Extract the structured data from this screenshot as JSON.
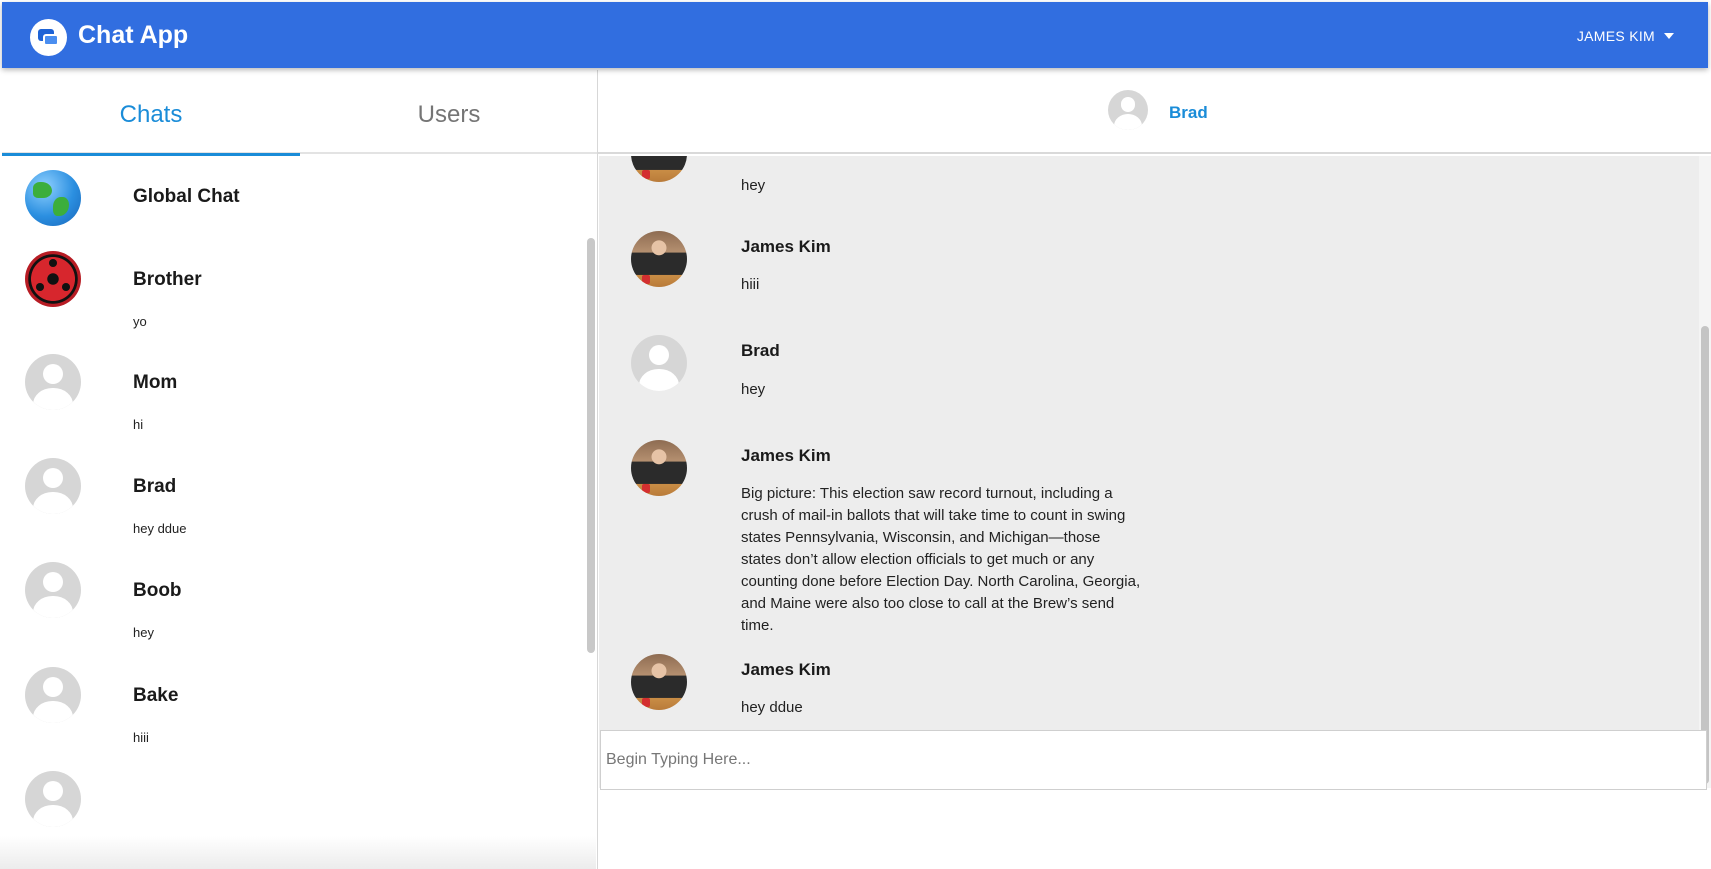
{
  "app": {
    "title": "Chat App",
    "current_user": "JAMES KIM"
  },
  "tabs": [
    {
      "label": "Chats",
      "active": true
    },
    {
      "label": "Users",
      "active": false
    }
  ],
  "chats": [
    {
      "name": "Global Chat",
      "preview": "",
      "avatar": "globe-icon"
    },
    {
      "name": "Brother",
      "preview": "yo",
      "avatar": "sharingan-icon"
    },
    {
      "name": "Mom",
      "preview": "hi",
      "avatar": "default-user-icon"
    },
    {
      "name": "Brad",
      "preview": "hey ddue",
      "avatar": "default-user-icon"
    },
    {
      "name": "Boob",
      "preview": "hey",
      "avatar": "default-user-icon"
    },
    {
      "name": "Bake",
      "preview": "hiii",
      "avatar": "default-user-icon"
    }
  ],
  "conversation": {
    "with": "Brad",
    "messages": [
      {
        "sender": "",
        "text": "hey"
      },
      {
        "sender": "James Kim",
        "text": "hiii"
      },
      {
        "sender": "Brad",
        "text": "hey"
      },
      {
        "sender": "James Kim",
        "text": "Big picture: This election saw record turnout, including a crush of mail-in ballots that will take time to count in swing states Pennsylvania, Wisconsin, and Michigan—those states don’t allow election officials to get much or any counting done before Election Day. North Carolina, Georgia, and Maine were also too close to call at the Brew’s send time."
      },
      {
        "sender": "James Kim",
        "text": "hey ddue"
      }
    ],
    "compose_placeholder": "Begin Typing Here..."
  },
  "colors": {
    "appbar": "#316ee0",
    "accent": "#1a8cd8",
    "message_bg": "#ededed"
  }
}
